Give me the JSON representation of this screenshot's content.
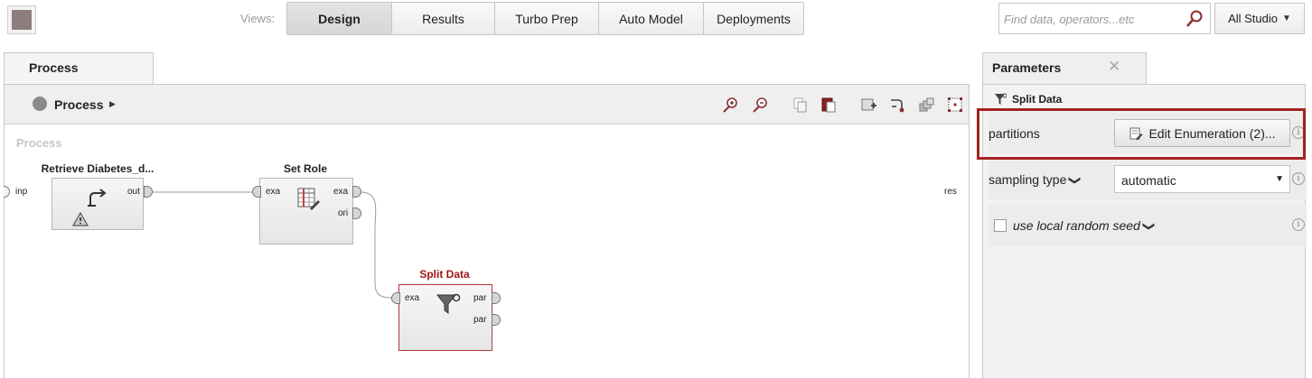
{
  "topbar": {
    "views_label": "Views:",
    "tabs": [
      {
        "label": "Design",
        "active": true
      },
      {
        "label": "Results",
        "active": false
      },
      {
        "label": "Turbo Prep",
        "active": false
      },
      {
        "label": "Auto Model",
        "active": false
      },
      {
        "label": "Deployments",
        "active": false
      }
    ],
    "search_placeholder": "Find data, operators...etc",
    "studio_label": "All Studio"
  },
  "process_panel": {
    "tab_label": "Process",
    "breadcrumb": "Process",
    "canvas_title": "Process",
    "input_port_label": "inp",
    "result_port_label": "res",
    "operators": [
      {
        "title": "Retrieve Diabetes_d...",
        "ports_in": [],
        "ports_out": [
          "out"
        ],
        "warning": true
      },
      {
        "title": "Set Role",
        "ports_in": [
          "exa"
        ],
        "ports_out": [
          "exa",
          "ori"
        ]
      },
      {
        "title": "Split Data",
        "ports_in": [
          "exa"
        ],
        "ports_out": [
          "par",
          "par"
        ],
        "selected": true
      }
    ]
  },
  "parameters_panel": {
    "tab_label": "Parameters",
    "operator_name": "Split Data",
    "partitions_label": "partitions",
    "partitions_button": "Edit Enumeration (2)...",
    "sampling_label": "sampling type",
    "sampling_value": "automatic",
    "seed_label": "use local random seed",
    "seed_checked": false
  },
  "colors": {
    "highlight": "#a5221f",
    "selected_operator_title": "#a31515"
  }
}
